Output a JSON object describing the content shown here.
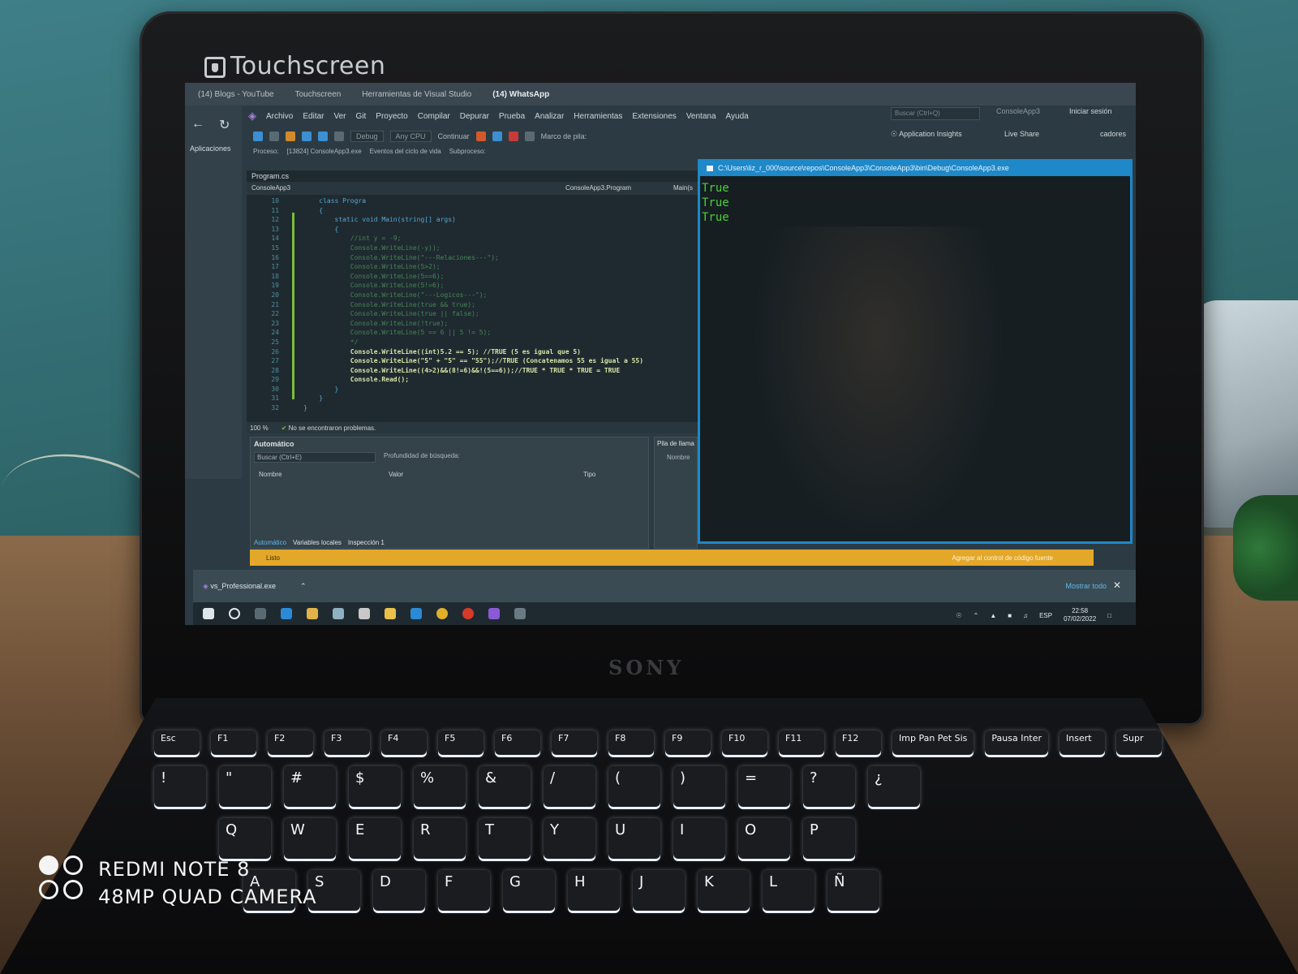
{
  "bezel": {
    "label": "Touchscreen",
    "brand": "SONY"
  },
  "browser": {
    "tabs": [
      "(14) Blogs - YouTube",
      "Touchscreen",
      "Herramientas de Visual Studio",
      "(14) WhatsApp"
    ],
    "side_apps": "Aplicaciones"
  },
  "vs": {
    "menu": [
      "Archivo",
      "Editar",
      "Ver",
      "Git",
      "Proyecto",
      "Compilar",
      "Depurar",
      "Prueba",
      "Analizar",
      "Herramientas",
      "Extensiones",
      "Ventana",
      "Ayuda"
    ],
    "search_placeholder": "Buscar (Ctrl+Q)",
    "project_name": "ConsoleApp3",
    "login": "Iniciar sesión",
    "toolbar": {
      "config": "Debug",
      "platform": "Any CPU",
      "continue": "Continuar",
      "marco": "Marco de pila:"
    },
    "app_insights": "Application Insights",
    "live_share": "Live Share",
    "cadores": "cadores",
    "process": {
      "label": "Proceso:",
      "value": "[13824] ConsoleApp3.exe",
      "events": "Eventos del ciclo de vida",
      "subproc": "Subproceso:"
    },
    "editor": {
      "file_tab": "Program.cs",
      "nav_left": "ConsoleApp3",
      "nav_mid": "ConsoleApp3.Program",
      "nav_right": "Main(s",
      "lines": [
        {
          "n": "10",
          "t": "    class Progra"
        },
        {
          "n": "11",
          "t": "    {"
        },
        {
          "n": "12",
          "t": "        static void Main(string[] args)"
        },
        {
          "n": "13",
          "t": "        {"
        },
        {
          "n": "14",
          "t": "            //int y = -9;"
        },
        {
          "n": "15",
          "t": "            Console.WriteLine(-y));"
        },
        {
          "n": "16",
          "t": "            Console.WriteLine(\"---Relaciones---\");"
        },
        {
          "n": "17",
          "t": "            Console.WriteLine(5>2);"
        },
        {
          "n": "18",
          "t": "            Console.WriteLine(5==6);"
        },
        {
          "n": "19",
          "t": "            Console.WriteLine(5!=6);"
        },
        {
          "n": "20",
          "t": "            Console.WriteLine(\"---Logicos---\");"
        },
        {
          "n": "21",
          "t": "            Console.WriteLine(true && true);"
        },
        {
          "n": "22",
          "t": "            Console.WriteLine(true || false);"
        },
        {
          "n": "23",
          "t": "            Console.WriteLine(!true);"
        },
        {
          "n": "24",
          "t": "            Console.WriteLine(5 == 6 || 5 != 5);"
        },
        {
          "n": "25",
          "t": "            */"
        },
        {
          "n": "26",
          "t": "            Console.WriteLine((int)5.2 == 5); //TRUE (5 es igual que 5)"
        },
        {
          "n": "27",
          "t": "            Console.WriteLine(\"5\" + \"5\" == \"55\");//TRUE (Concatenamos 55 es igual a 55)"
        },
        {
          "n": "28",
          "t": "            Console.WriteLine((4>2)&&(8!=6)&&!(5==6));//TRUE * TRUE * TRUE = TRUE"
        },
        {
          "n": "29",
          "t": "            Console.Read();"
        },
        {
          "n": "30",
          "t": "        }"
        },
        {
          "n": "31",
          "t": "    }"
        },
        {
          "n": "32",
          "t": "}"
        }
      ],
      "zoom": "100 %",
      "status": "No se encontraron problemas."
    },
    "auto_panel": {
      "title": "Automático",
      "search": "Buscar (Ctrl+E)",
      "depth": "Profundidad de búsqueda:",
      "cols": [
        "Nombre",
        "Valor",
        "Tipo"
      ],
      "tabs": [
        "Automático",
        "Variables locales",
        "Inspección 1"
      ]
    },
    "pila": {
      "title": "Pila de llama",
      "col": "Nombre",
      "tab": "Pila de llam"
    },
    "statusbar": {
      "left": "Listo",
      "right": "Agregar al control de código fuente"
    }
  },
  "console": {
    "title": "C:\\Users\\liz_r_000\\source\\repos\\ConsoleApp3\\ConsoleApp3\\bin\\Debug\\ConsoleApp3.exe",
    "lines": [
      "True",
      "True",
      "True"
    ],
    "colors": {
      "border": "#1e88c8",
      "text": "#4ccf3a"
    }
  },
  "downloads": {
    "file": "vs_Professional.exe",
    "show_all": "Mostrar todo"
  },
  "taskbar": {
    "lang": "ESP",
    "time": "22:58",
    "date": "07/02/2022"
  },
  "keyboard": {
    "fn_row": [
      "Esc",
      "F1",
      "F2",
      "F3",
      "F4",
      "F5",
      "F6",
      "F7",
      "F8",
      "F9",
      "F10",
      "F11",
      "F12",
      "Imp Pan Pet Sis",
      "Pausa Inter",
      "Insert",
      "Supr"
    ],
    "num_row": [
      "!",
      "\"",
      "#",
      "$",
      "%",
      "&",
      "/",
      "(",
      ")",
      "=",
      "?",
      "¿"
    ],
    "qwerty": [
      "Q",
      "W",
      "E",
      "R",
      "T",
      "Y",
      "U",
      "I",
      "O",
      "P"
    ],
    "asdf": [
      "A",
      "S",
      "D",
      "F",
      "G",
      "H",
      "J",
      "K",
      "L",
      "Ñ"
    ]
  },
  "watermark": {
    "line1": "REDMI NOTE 8",
    "line2": "48MP QUAD CAMERA"
  }
}
